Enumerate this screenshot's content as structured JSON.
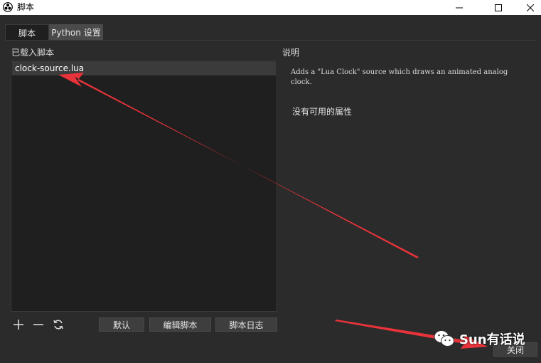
{
  "window": {
    "title": "脚本",
    "controls": {
      "minimize_icon": "minimize-icon",
      "maximize_icon": "maximize-icon",
      "close_icon": "close-icon"
    }
  },
  "tabs": [
    {
      "label": "脚本",
      "active": true
    },
    {
      "label": "Python 设置",
      "active": false
    }
  ],
  "loaded_scripts": {
    "label": "已载入脚本",
    "items": [
      "clock-source.lua"
    ]
  },
  "description": {
    "label": "说明",
    "text": "Adds a \"Lua Clock\" source which draws an animated analog clock.",
    "no_properties": "没有可用的属性"
  },
  "toolbar": {
    "add_icon": "plus-icon",
    "remove_icon": "minus-icon",
    "reload_icon": "refresh-icon",
    "default_label": "默认",
    "edit_label": "编辑脚本",
    "log_label": "脚本日志"
  },
  "footer": {
    "close_label": "关闭"
  },
  "watermark": {
    "text": "Sun有话说"
  },
  "colors": {
    "background": "#2b2b2b",
    "list_bg": "#1f1f1f",
    "annotation_arrow": "#e8333a"
  }
}
